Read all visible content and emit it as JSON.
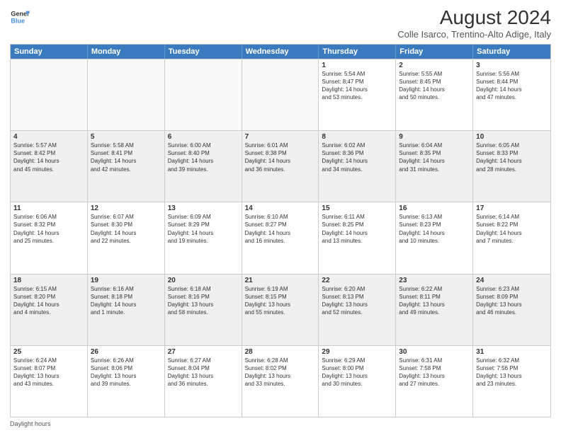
{
  "logo": {
    "line1": "General",
    "line2": "Blue"
  },
  "title": "August 2024",
  "subtitle": "Colle Isarco, Trentino-Alto Adige, Italy",
  "header_days": [
    "Sunday",
    "Monday",
    "Tuesday",
    "Wednesday",
    "Thursday",
    "Friday",
    "Saturday"
  ],
  "footer": "Daylight hours",
  "weeks": [
    [
      {
        "day": "",
        "info": ""
      },
      {
        "day": "",
        "info": ""
      },
      {
        "day": "",
        "info": ""
      },
      {
        "day": "",
        "info": ""
      },
      {
        "day": "1",
        "info": "Sunrise: 5:54 AM\nSunset: 8:47 PM\nDaylight: 14 hours\nand 53 minutes."
      },
      {
        "day": "2",
        "info": "Sunrise: 5:55 AM\nSunset: 8:45 PM\nDaylight: 14 hours\nand 50 minutes."
      },
      {
        "day": "3",
        "info": "Sunrise: 5:56 AM\nSunset: 8:44 PM\nDaylight: 14 hours\nand 47 minutes."
      }
    ],
    [
      {
        "day": "4",
        "info": "Sunrise: 5:57 AM\nSunset: 8:42 PM\nDaylight: 14 hours\nand 45 minutes."
      },
      {
        "day": "5",
        "info": "Sunrise: 5:58 AM\nSunset: 8:41 PM\nDaylight: 14 hours\nand 42 minutes."
      },
      {
        "day": "6",
        "info": "Sunrise: 6:00 AM\nSunset: 8:40 PM\nDaylight: 14 hours\nand 39 minutes."
      },
      {
        "day": "7",
        "info": "Sunrise: 6:01 AM\nSunset: 8:38 PM\nDaylight: 14 hours\nand 36 minutes."
      },
      {
        "day": "8",
        "info": "Sunrise: 6:02 AM\nSunset: 8:36 PM\nDaylight: 14 hours\nand 34 minutes."
      },
      {
        "day": "9",
        "info": "Sunrise: 6:04 AM\nSunset: 8:35 PM\nDaylight: 14 hours\nand 31 minutes."
      },
      {
        "day": "10",
        "info": "Sunrise: 6:05 AM\nSunset: 8:33 PM\nDaylight: 14 hours\nand 28 minutes."
      }
    ],
    [
      {
        "day": "11",
        "info": "Sunrise: 6:06 AM\nSunset: 8:32 PM\nDaylight: 14 hours\nand 25 minutes."
      },
      {
        "day": "12",
        "info": "Sunrise: 6:07 AM\nSunset: 8:30 PM\nDaylight: 14 hours\nand 22 minutes."
      },
      {
        "day": "13",
        "info": "Sunrise: 6:09 AM\nSunset: 8:29 PM\nDaylight: 14 hours\nand 19 minutes."
      },
      {
        "day": "14",
        "info": "Sunrise: 6:10 AM\nSunset: 8:27 PM\nDaylight: 14 hours\nand 16 minutes."
      },
      {
        "day": "15",
        "info": "Sunrise: 6:11 AM\nSunset: 8:25 PM\nDaylight: 14 hours\nand 13 minutes."
      },
      {
        "day": "16",
        "info": "Sunrise: 6:13 AM\nSunset: 8:23 PM\nDaylight: 14 hours\nand 10 minutes."
      },
      {
        "day": "17",
        "info": "Sunrise: 6:14 AM\nSunset: 8:22 PM\nDaylight: 14 hours\nand 7 minutes."
      }
    ],
    [
      {
        "day": "18",
        "info": "Sunrise: 6:15 AM\nSunset: 8:20 PM\nDaylight: 14 hours\nand 4 minutes."
      },
      {
        "day": "19",
        "info": "Sunrise: 6:16 AM\nSunset: 8:18 PM\nDaylight: 14 hours\nand 1 minute."
      },
      {
        "day": "20",
        "info": "Sunrise: 6:18 AM\nSunset: 8:16 PM\nDaylight: 13 hours\nand 58 minutes."
      },
      {
        "day": "21",
        "info": "Sunrise: 6:19 AM\nSunset: 8:15 PM\nDaylight: 13 hours\nand 55 minutes."
      },
      {
        "day": "22",
        "info": "Sunrise: 6:20 AM\nSunset: 8:13 PM\nDaylight: 13 hours\nand 52 minutes."
      },
      {
        "day": "23",
        "info": "Sunrise: 6:22 AM\nSunset: 8:11 PM\nDaylight: 13 hours\nand 49 minutes."
      },
      {
        "day": "24",
        "info": "Sunrise: 6:23 AM\nSunset: 8:09 PM\nDaylight: 13 hours\nand 46 minutes."
      }
    ],
    [
      {
        "day": "25",
        "info": "Sunrise: 6:24 AM\nSunset: 8:07 PM\nDaylight: 13 hours\nand 43 minutes."
      },
      {
        "day": "26",
        "info": "Sunrise: 6:26 AM\nSunset: 8:06 PM\nDaylight: 13 hours\nand 39 minutes."
      },
      {
        "day": "27",
        "info": "Sunrise: 6:27 AM\nSunset: 8:04 PM\nDaylight: 13 hours\nand 36 minutes."
      },
      {
        "day": "28",
        "info": "Sunrise: 6:28 AM\nSunset: 8:02 PM\nDaylight: 13 hours\nand 33 minutes."
      },
      {
        "day": "29",
        "info": "Sunrise: 6:29 AM\nSunset: 8:00 PM\nDaylight: 13 hours\nand 30 minutes."
      },
      {
        "day": "30",
        "info": "Sunrise: 6:31 AM\nSunset: 7:58 PM\nDaylight: 13 hours\nand 27 minutes."
      },
      {
        "day": "31",
        "info": "Sunrise: 6:32 AM\nSunset: 7:56 PM\nDaylight: 13 hours\nand 23 minutes."
      }
    ]
  ]
}
